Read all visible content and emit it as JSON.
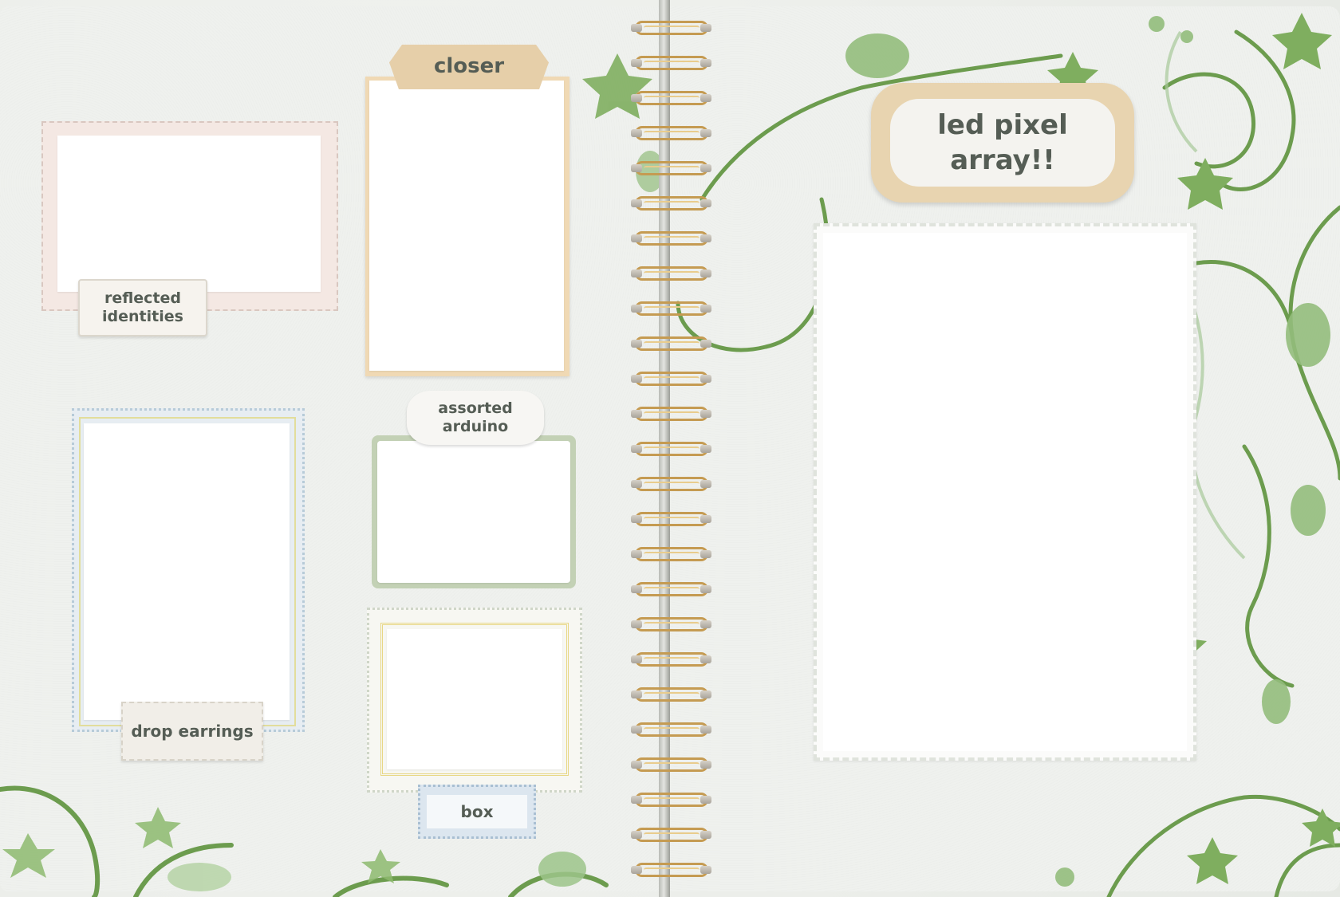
{
  "scrapbook": {
    "left_page": {
      "frames": [
        {
          "label": "reflected\nidentities"
        },
        {
          "label": "closer"
        },
        {
          "label": "drop earrings"
        },
        {
          "label": "assorted\narduino"
        },
        {
          "label": "box"
        }
      ]
    },
    "right_page": {
      "title": "led pixel\narray!!"
    }
  },
  "colors": {
    "page": "#eff1ee",
    "label_text": "#555d55",
    "ivy_green": "#6c9c4e",
    "ivy_light": "#a8c99a",
    "ring_gold": "#c59b52",
    "tag_tan": "#e8d4b0"
  },
  "icons": [
    "star-leaf-icon",
    "ivy-vine-icon",
    "spiral-ring-icon"
  ]
}
